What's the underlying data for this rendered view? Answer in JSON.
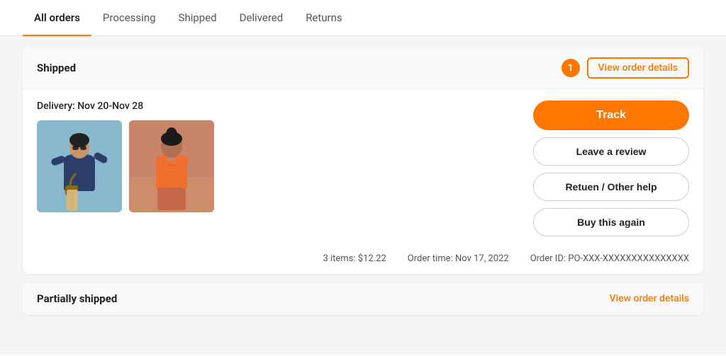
{
  "tabs": [
    {
      "id": "all-orders",
      "label": "All orders",
      "active": true
    },
    {
      "id": "processing",
      "label": "Processing",
      "active": false
    },
    {
      "id": "shipped",
      "label": "Shipped",
      "active": false
    },
    {
      "id": "delivered",
      "label": "Delivered",
      "active": false
    },
    {
      "id": "returns",
      "label": "Returns",
      "active": false
    }
  ],
  "order_card": {
    "status": "Shipped",
    "badge_count": "1",
    "view_details_label": "View order details",
    "delivery_text": "Delivery: Nov 20-Nov 28",
    "track_label": "Track",
    "leave_review_label": "Leave a review",
    "return_help_label": "Retuen / Other help",
    "buy_again_label": "Buy this again",
    "footer": {
      "items_count": "3 items:",
      "items_price": "$12.22",
      "order_time_label": "Order time:",
      "order_time_value": "Nov 17, 2022",
      "order_id_label": "Order ID:",
      "order_id_value": "PO-XXX-XXXXXXXXXXXXXXX"
    }
  },
  "partial_card": {
    "status": "Partially shipped",
    "view_details_label": "View order details"
  }
}
